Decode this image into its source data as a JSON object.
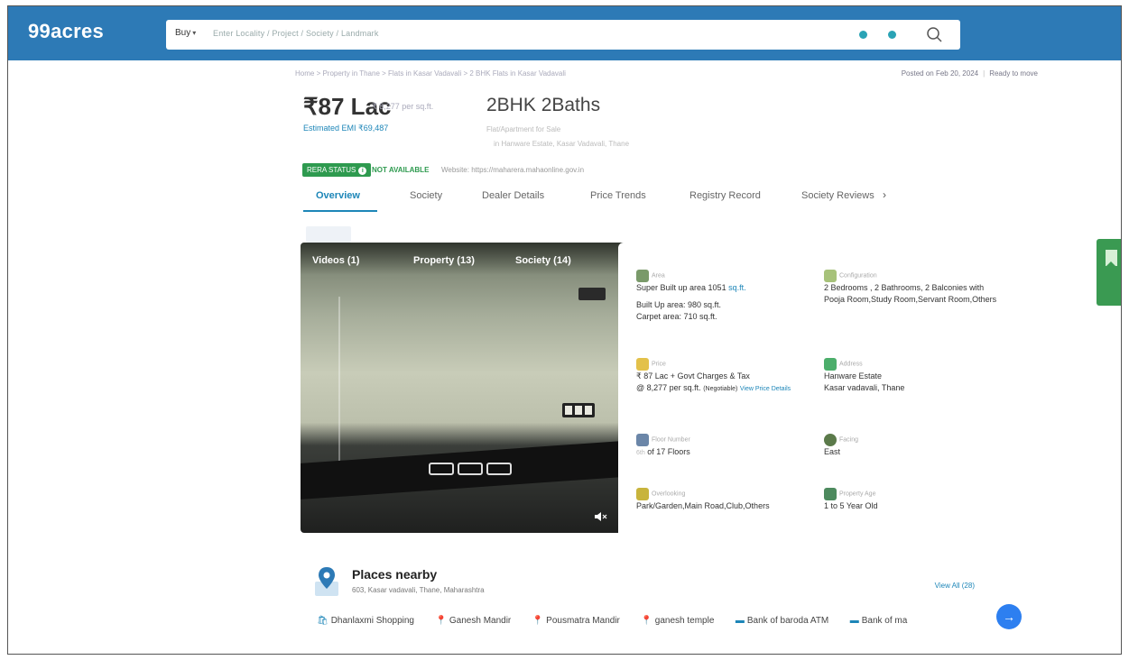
{
  "header": {
    "logo": "99acres",
    "buy_label": "Buy",
    "search_placeholder": "Enter Locality / Project / Society / Landmark"
  },
  "breadcrumb": "Home > Property in Thane > Flats in Kasar Vadavali > 2 BHK Flats in Kasar Vadavali",
  "posted": {
    "date": "Posted on Feb 20, 2024",
    "status": "Ready to move"
  },
  "listing": {
    "price": "₹87 Lac",
    "price_per_sqft": "₹ 8,277 per sq.ft.",
    "emi": "Estimated EMI ₹69,487",
    "title": "2BHK 2Baths",
    "subtitle1": "Flat/Apartment for Sale",
    "subtitle2": "in Hanware Estate, Kasar Vadavali, Thane"
  },
  "rera": {
    "badge": "RERA STATUS",
    "status": "NOT AVAILABLE",
    "website": "Website: https://maharera.mahaonline.gov.in"
  },
  "tabs": [
    "Overview",
    "Society",
    "Dealer Details",
    "Price Trends",
    "Registry Record",
    "Society Reviews"
  ],
  "media": {
    "tabs": [
      "Videos (1)",
      "Property (13)",
      "Society (14)"
    ]
  },
  "details": {
    "area": {
      "label": "Area",
      "line1": "Super Built up area 1051",
      "unit": "sq.ft.",
      "line2": "Built Up area: 980 sq.ft.",
      "line3": "Carpet area: 710 sq.ft."
    },
    "configuration": {
      "label": "Configuration",
      "value": "2 Bedrooms , 2 Bathrooms, 2 Balconies with Pooja Room,Study Room,Servant Room,Others"
    },
    "price": {
      "label": "Price",
      "line1": "₹ 87 Lac + Govt Charges & Tax",
      "line2": "@ 8,277 per sq.ft.",
      "negotiable": "(Negotiable)",
      "link": "View Price Details"
    },
    "address": {
      "label": "Address",
      "line1": "Hanware Estate",
      "line2": "Kasar vadavali, Thane"
    },
    "floor": {
      "label": "Floor Number",
      "value": "of 17 Floors",
      "prefix": "6th"
    },
    "facing": {
      "label": "Facing",
      "value": "East"
    },
    "overlooking": {
      "label": "Overlooking",
      "value": "Park/Garden,Main Road,Club,Others"
    },
    "property_age": {
      "label": "Property Age",
      "value": "1 to 5 Year Old"
    }
  },
  "places": {
    "title": "Places nearby",
    "address": "603, Kasar vadavali, Thane, Maharashtra",
    "view_all": "View All (28)",
    "chips": [
      "Dhanlaxmi Shopping",
      "Ganesh Mandir",
      "Pousmatra Mandir",
      "ganesh temple",
      "Bank of baroda ATM",
      "Bank of ma"
    ]
  },
  "colors": {
    "brand_blue": "#2d7ab6",
    "link_blue": "#1d86b8",
    "rera_green": "#2e9a4f",
    "side_tab_green": "#3a9a52"
  }
}
